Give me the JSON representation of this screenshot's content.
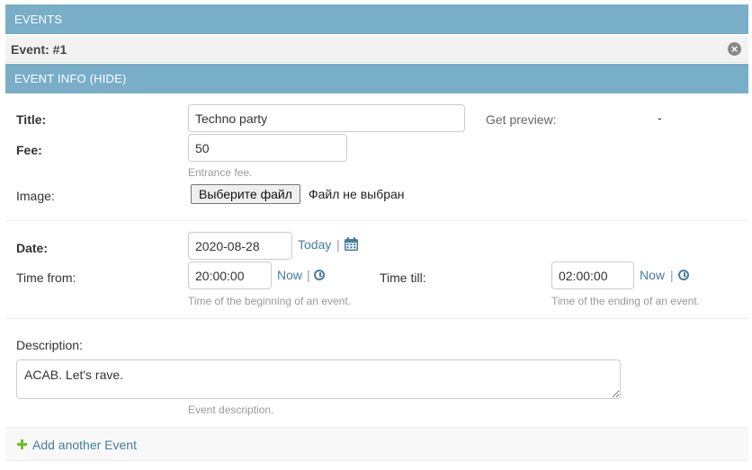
{
  "header": {
    "title": "EVENTS"
  },
  "inline": {
    "title": "Event: #1"
  },
  "section": {
    "title": "EVENT INFO (HIDE)"
  },
  "form": {
    "title_label": "Title:",
    "title_value": "Techno party",
    "preview_label": "Get preview:",
    "preview_value": "-",
    "fee_label": "Fee:",
    "fee_value": "50",
    "fee_help": "Entrance fee.",
    "image_label": "Image:",
    "file_button": "Выберите файл",
    "file_status": "Файл не выбран",
    "date_label": "Date:",
    "date_value": "2020-08-28",
    "today_link": "Today",
    "time_from_label": "Time from:",
    "time_from_value": "20:00:00",
    "time_from_now": "Now",
    "time_from_help": "Time of the beginning of an event.",
    "time_till_label": "Time till:",
    "time_till_value": "02:00:00",
    "time_till_now": "Now",
    "time_till_help": "Time of the ending of an event.",
    "description_label": "Description:",
    "description_value": "ACAB. Let's rave.",
    "description_help": "Event description.",
    "separator": "|"
  },
  "footer": {
    "add_label": "Add another Event"
  },
  "colors": {
    "header_bg": "#79aec8",
    "link": "#447e9b",
    "add_icon": "#70bf2b"
  }
}
